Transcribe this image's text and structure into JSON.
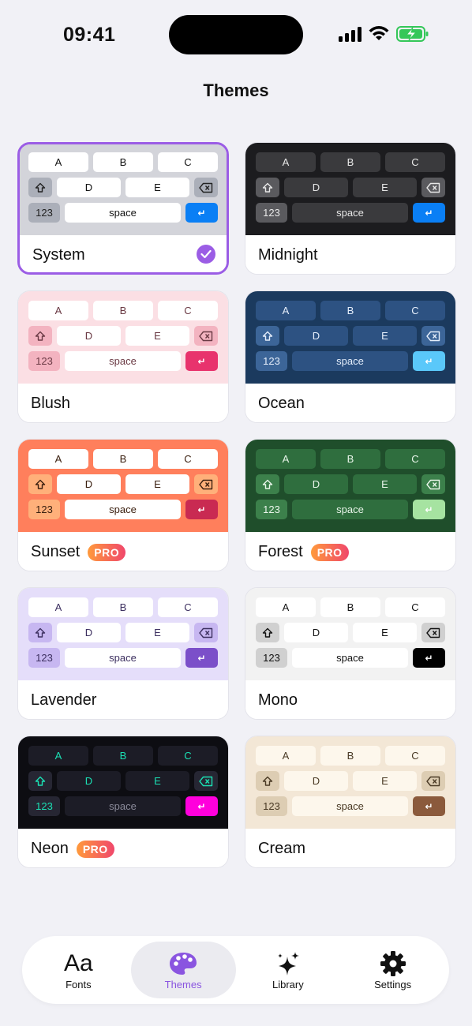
{
  "status": {
    "time": "09:41"
  },
  "page": {
    "title": "Themes"
  },
  "keys": {
    "row1": [
      "A",
      "B",
      "C"
    ],
    "row2": [
      "D",
      "E"
    ],
    "numbers": "123",
    "space": "space"
  },
  "themes": [
    {
      "name": "System",
      "pro": false,
      "selected": true,
      "bg": "#d3d4da",
      "key": "#ffffff",
      "mod": "#abafb9",
      "text": "#111111",
      "modText": "#222222",
      "ret": "#0a7ff5",
      "retText": "#ffffff"
    },
    {
      "name": "Midnight",
      "pro": false,
      "selected": false,
      "bg": "#1c1c1f",
      "key": "#3a3a3d",
      "mod": "#5a5a5e",
      "text": "#e8e8e8",
      "modText": "#e8e8e8",
      "ret": "#0a7ff5",
      "retText": "#ffffff"
    },
    {
      "name": "Blush",
      "pro": false,
      "selected": false,
      "bg": "#fbdfe4",
      "key": "#ffffff",
      "mod": "#f3b3c0",
      "text": "#6a3a44",
      "modText": "#6a3a44",
      "ret": "#e8336d",
      "retText": "#ffffff"
    },
    {
      "name": "Ocean",
      "pro": false,
      "selected": false,
      "bg": "#1b3a5e",
      "key": "#2d5282",
      "mod": "#3c6598",
      "text": "#e5eefb",
      "modText": "#e5eefb",
      "ret": "#5ac8fa",
      "retText": "#ffffff"
    },
    {
      "name": "Sunset",
      "pro": true,
      "selected": false,
      "bg": "#ff7f5c",
      "key": "#ffffff",
      "mod": "#ffb07a",
      "text": "#3b2010",
      "modText": "#3b2010",
      "ret": "#c92a52",
      "retText": "#ffffff"
    },
    {
      "name": "Forest",
      "pro": true,
      "selected": false,
      "bg": "#1f4e2b",
      "key": "#2f6e3e",
      "mod": "#3c804b",
      "text": "#e9f5ea",
      "modText": "#e9f5ea",
      "ret": "#a6e3a1",
      "retText": "#ffffff"
    },
    {
      "name": "Lavender",
      "pro": false,
      "selected": false,
      "bg": "#e5defa",
      "key": "#ffffff",
      "mod": "#c7b7f1",
      "text": "#3d3060",
      "modText": "#3d3060",
      "ret": "#7b4fc9",
      "retText": "#ffffff"
    },
    {
      "name": "Mono",
      "pro": false,
      "selected": false,
      "bg": "#f2f2f2",
      "key": "#ffffff",
      "mod": "#d0d0d0",
      "text": "#111111",
      "modText": "#111111",
      "ret": "#000000",
      "retText": "#ffffff"
    },
    {
      "name": "Neon",
      "pro": true,
      "selected": false,
      "bg": "#0d0d12",
      "key": "#1c1c26",
      "mod": "#262633",
      "text": "#1be0b4",
      "modText": "#1be0b4",
      "ret": "#ff00dc",
      "retText": "#ffffff",
      "numText": "#1be0b4",
      "spaceText": "#8a8a99"
    },
    {
      "name": "Cream",
      "pro": false,
      "selected": false,
      "bg": "#f3e7d6",
      "key": "#fdf7ec",
      "mod": "#ddcdb3",
      "text": "#4a3a25",
      "modText": "#4a3a25",
      "ret": "#8b5a3c",
      "retText": "#ffffff"
    }
  ],
  "badges": {
    "pro": "PRO"
  },
  "tabs": [
    {
      "label": "Fonts",
      "icon": "fonts-icon",
      "active": false
    },
    {
      "label": "Themes",
      "icon": "palette-icon",
      "active": true
    },
    {
      "label": "Library",
      "icon": "sparkles-icon",
      "active": false
    },
    {
      "label": "Settings",
      "icon": "gear-icon",
      "active": false
    }
  ],
  "colors": {
    "accent": "#9b5de5",
    "tabActive": "#8a55e0",
    "background": "#f1f1f6"
  }
}
